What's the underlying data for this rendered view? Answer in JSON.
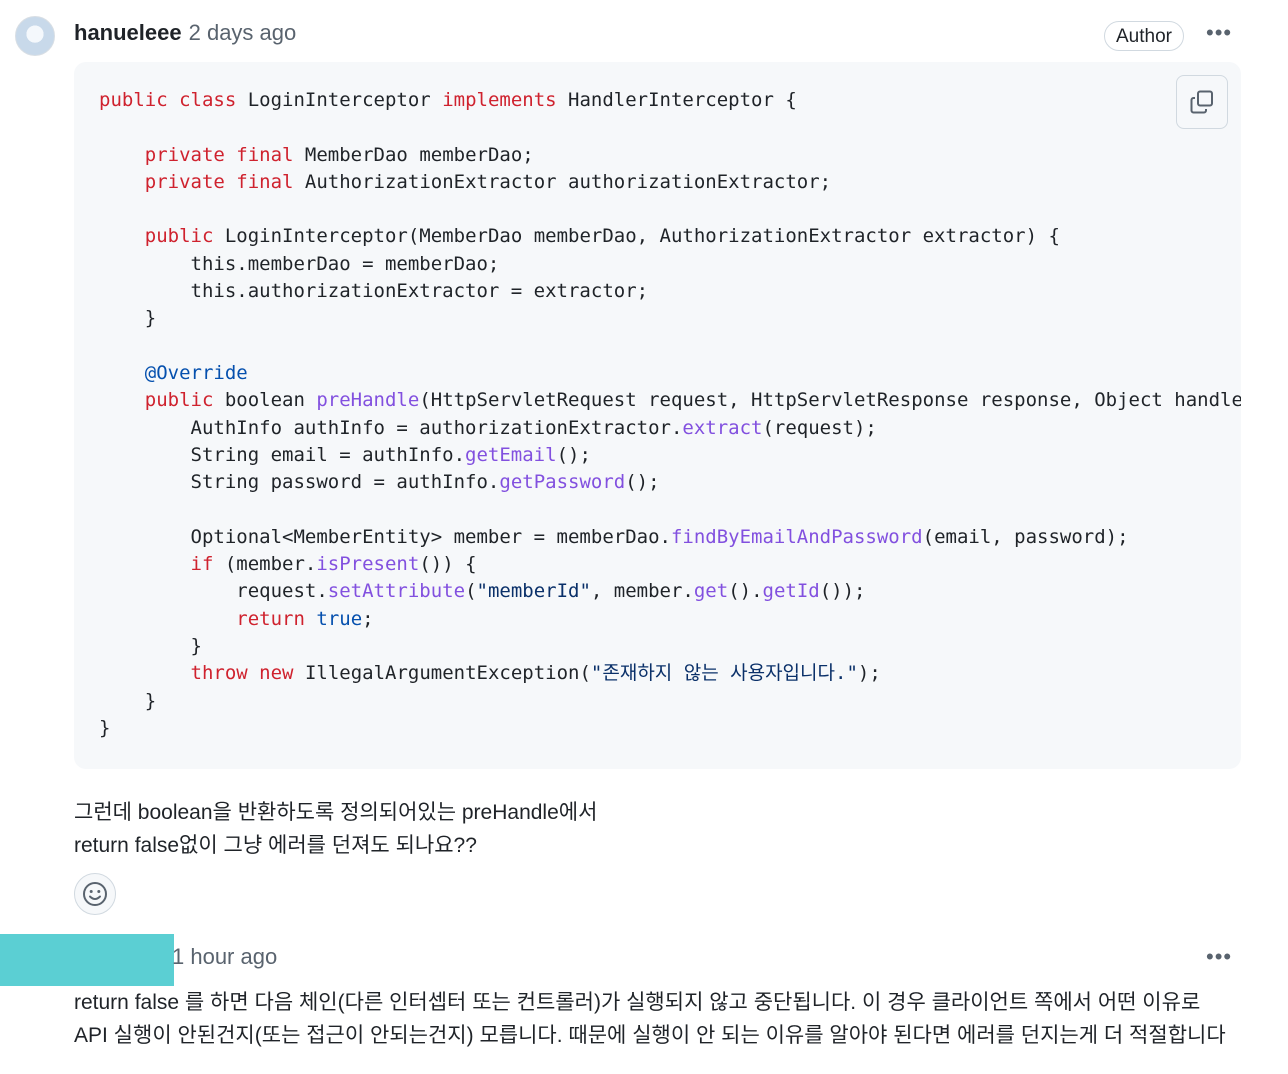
{
  "comment1": {
    "username": "hanueleee",
    "time": "2 days ago",
    "badge": "Author",
    "menu": "•••",
    "code_lines": [
      [
        {
          "t": "public class",
          "c": "kw"
        },
        {
          "t": " LoginInterceptor "
        },
        {
          "t": "implements",
          "c": "kw"
        },
        {
          "t": " HandlerInterceptor {"
        }
      ],
      [],
      [
        {
          "t": "    "
        },
        {
          "t": "private final",
          "c": "kw"
        },
        {
          "t": " MemberDao memberDao;"
        }
      ],
      [
        {
          "t": "    "
        },
        {
          "t": "private final",
          "c": "kw"
        },
        {
          "t": " AuthorizationExtractor authorizationExtractor;"
        }
      ],
      [],
      [
        {
          "t": "    "
        },
        {
          "t": "public",
          "c": "kw"
        },
        {
          "t": " LoginInterceptor(MemberDao memberDao, AuthorizationExtractor extractor) {"
        }
      ],
      [
        {
          "t": "        this.memberDao = memberDao;"
        }
      ],
      [
        {
          "t": "        this.authorizationExtractor = extractor;"
        }
      ],
      [
        {
          "t": "    }"
        }
      ],
      [],
      [
        {
          "t": "    "
        },
        {
          "t": "@Override",
          "c": "an"
        }
      ],
      [
        {
          "t": "    "
        },
        {
          "t": "public",
          "c": "kw"
        },
        {
          "t": " boolean "
        },
        {
          "t": "preHandle",
          "c": "fn"
        },
        {
          "t": "(HttpServletRequest request, HttpServletResponse response, Object handler"
        }
      ],
      [
        {
          "t": "        AuthInfo authInfo = authorizationExtractor."
        },
        {
          "t": "extract",
          "c": "fn"
        },
        {
          "t": "(request);"
        }
      ],
      [
        {
          "t": "        String email = authInfo."
        },
        {
          "t": "getEmail",
          "c": "fn"
        },
        {
          "t": "();"
        }
      ],
      [
        {
          "t": "        String password = authInfo."
        },
        {
          "t": "getPassword",
          "c": "fn"
        },
        {
          "t": "();"
        }
      ],
      [],
      [
        {
          "t": "        Optional<MemberEntity> member = memberDao."
        },
        {
          "t": "findByEmailAndPassword",
          "c": "fn"
        },
        {
          "t": "(email, password);"
        }
      ],
      [
        {
          "t": "        "
        },
        {
          "t": "if",
          "c": "kw"
        },
        {
          "t": " (member."
        },
        {
          "t": "isPresent",
          "c": "fn"
        },
        {
          "t": "()) {"
        }
      ],
      [
        {
          "t": "            request."
        },
        {
          "t": "setAttribute",
          "c": "fn"
        },
        {
          "t": "("
        },
        {
          "t": "\"memberId\"",
          "c": "st"
        },
        {
          "t": ", member."
        },
        {
          "t": "get",
          "c": "fn"
        },
        {
          "t": "()."
        },
        {
          "t": "getId",
          "c": "fn"
        },
        {
          "t": "());"
        }
      ],
      [
        {
          "t": "            "
        },
        {
          "t": "return",
          "c": "kw"
        },
        {
          "t": " "
        },
        {
          "t": "true",
          "c": "an"
        },
        {
          "t": ";"
        }
      ],
      [
        {
          "t": "        }"
        }
      ],
      [
        {
          "t": "        "
        },
        {
          "t": "throw",
          "c": "kw"
        },
        {
          "t": " "
        },
        {
          "t": "new",
          "c": "kw"
        },
        {
          "t": " IllegalArgumentException("
        },
        {
          "t": "\"존재하지 않는 사용자입니다.\"",
          "c": "st"
        },
        {
          "t": ");"
        }
      ],
      [
        {
          "t": "    }"
        }
      ],
      [
        {
          "t": "}"
        }
      ]
    ],
    "text_line1": "그런데 boolean을 반환하도록 정의되어있는 preHandle에서",
    "text_line2": "return false없이 그냥 에러를 던져도 되나요??"
  },
  "comment2": {
    "time": "1 hour ago",
    "menu": "•••",
    "text_line1": "return false 를 하면 다음 체인(다른 인터셉터 또는 컨트롤러)가 실행되지 않고 중단됩니다. 이 경우 클라이언트 쪽에서 어떤 이유로",
    "text_line2": "API 실행이 안된건지(또는 접근이 안되는건지) 모릅니다. 때문에 실행이 안 되는 이유를 알아야 된다면 에러를 던지는게 더 적절합니다"
  }
}
